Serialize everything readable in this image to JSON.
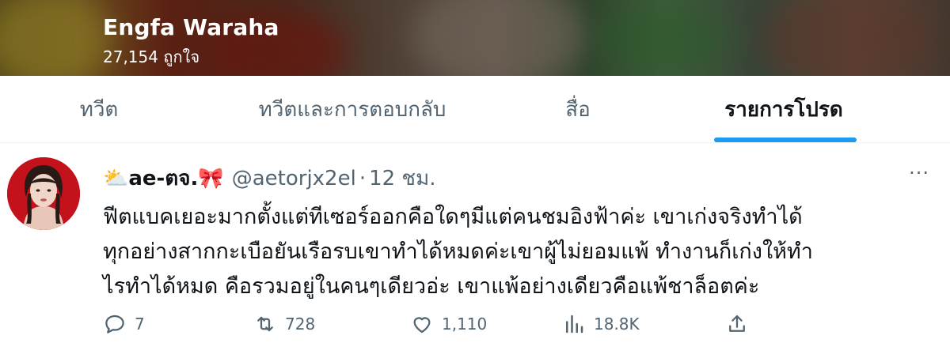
{
  "profile": {
    "name": "Engfa Waraha",
    "likes_count": "27,154 ถูกใจ"
  },
  "tabs": [
    {
      "label": "ทวีต",
      "active": false
    },
    {
      "label": "ทวีตและการตอบกลับ",
      "active": false
    },
    {
      "label": "สื่อ",
      "active": false
    },
    {
      "label": "รายการโปรด",
      "active": true
    }
  ],
  "tweet": {
    "display_name": "⛅ae-ตจ.🎀",
    "handle": "@aetorjx2el",
    "separator": "·",
    "time": "12 ชม.",
    "more": "···",
    "lines": [
      "ฟีตแบคเยอะมากตั้งแต่ทีเซอร์ออกคือใดๆมีแต่คนชมอิงฟ้าค่ะ เขาเก่งจริงทำได้",
      "ทุกอย่างสากกะเบือยันเรือรบเขาทำได้หมดค่ะเขาผู้ไม่ยอมแพ้ ทำงานก็เก่งให้ทำ",
      "ไรทำได้หมด คือรวมอยู่ในคนๆเดียวอ่ะ เขาแพ้อย่างเดียวคือแพ้ชาล็อตค่ะ"
    ],
    "actions": {
      "replies": "7",
      "retweets": "728",
      "likes": "1,110",
      "views": "18.8K"
    }
  },
  "colors": {
    "accent": "#1d9bf0",
    "secondary_text": "#536471",
    "primary_text": "#0f1419"
  }
}
